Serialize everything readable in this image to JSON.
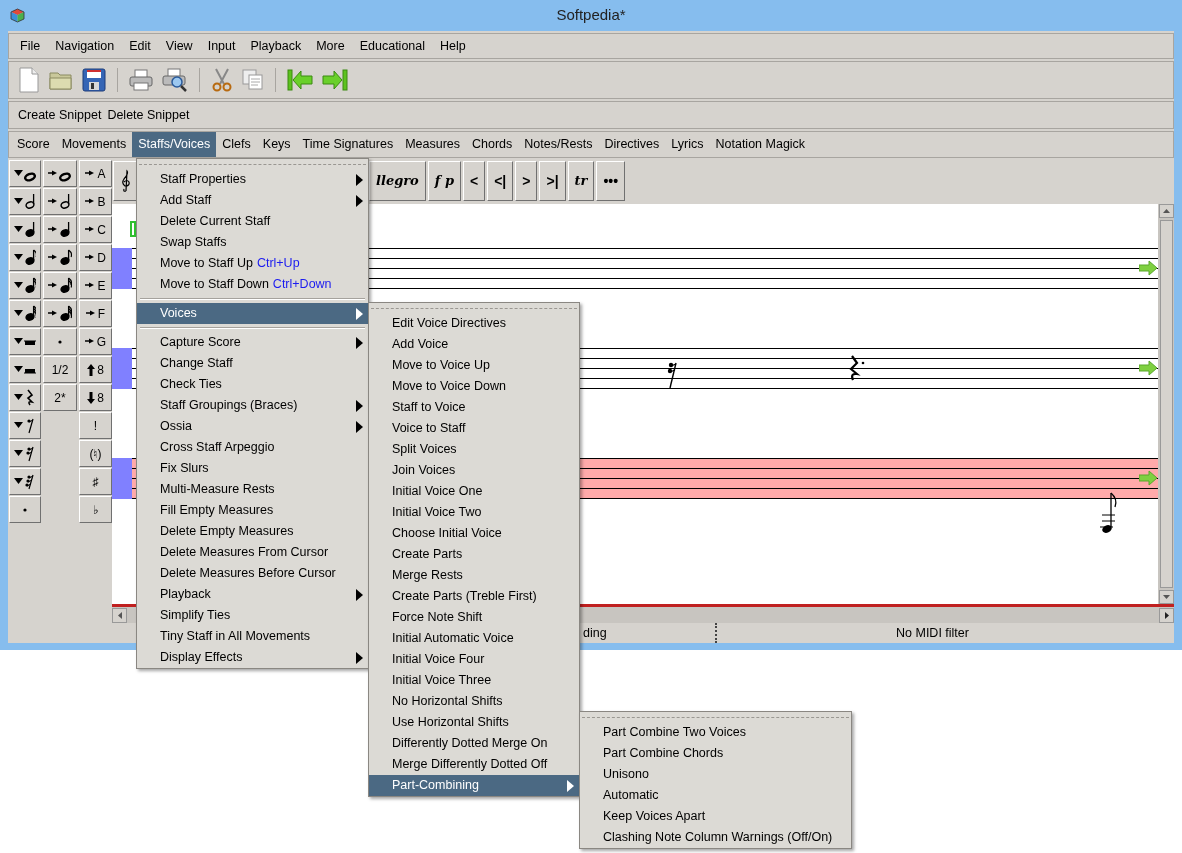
{
  "window": {
    "title": "Softpedia*"
  },
  "menu_bar": [
    "File",
    "Navigation",
    "Edit",
    "View",
    "Input",
    "Playback",
    "More",
    "Educational",
    "Help"
  ],
  "snippet_bar": [
    "Create Snippet",
    "Delete Snippet"
  ],
  "tabs": [
    {
      "label": "Score",
      "selected": false
    },
    {
      "label": "Movements",
      "selected": false
    },
    {
      "label": "Staffs/Voices",
      "selected": true
    },
    {
      "label": "Clefs",
      "selected": false
    },
    {
      "label": "Keys",
      "selected": false
    },
    {
      "label": "Time Signatures",
      "selected": false
    },
    {
      "label": "Measures",
      "selected": false
    },
    {
      "label": "Chords",
      "selected": false
    },
    {
      "label": "Notes/Rests",
      "selected": false
    },
    {
      "label": "Directives",
      "selected": false
    },
    {
      "label": "Lyrics",
      "selected": false
    },
    {
      "label": "Notation Magick",
      "selected": false
    }
  ],
  "palette_columns": [
    [
      {
        "kind": "insertwhole"
      },
      {
        "kind": "inserthalf"
      },
      {
        "kind": "insertquarter"
      },
      {
        "kind": "inserteighth"
      },
      {
        "kind": "insertsixteenth"
      },
      {
        "kind": "insertthirtysecond"
      },
      {
        "kind": "insertwholerest"
      },
      {
        "kind": "inserthalfrest"
      },
      {
        "kind": "insertquarterrest"
      },
      {
        "kind": "inserteighthrest"
      },
      {
        "kind": "insertsixteenthrest"
      },
      {
        "kind": "insertthirtysecondrest"
      },
      {
        "kind": "dot"
      }
    ],
    [
      {
        "kind": "appendwhole"
      },
      {
        "kind": "appendhalf"
      },
      {
        "kind": "appendquarter"
      },
      {
        "kind": "appendeighth"
      },
      {
        "kind": "appendsixteenth"
      },
      {
        "kind": "appendthirtysecond"
      },
      {
        "kind": "dot"
      },
      {
        "kind": "text",
        "label": "1/2"
      },
      {
        "kind": "text",
        "label": "2*"
      }
    ],
    [
      {
        "kind": "pitch",
        "label": "A"
      },
      {
        "kind": "pitch",
        "label": "B"
      },
      {
        "kind": "pitch",
        "label": "C"
      },
      {
        "kind": "pitch",
        "label": "D"
      },
      {
        "kind": "pitch",
        "label": "E"
      },
      {
        "kind": "pitch",
        "label": "F"
      },
      {
        "kind": "pitch",
        "label": "G"
      },
      {
        "kind": "octave-up",
        "label": "8"
      },
      {
        "kind": "octave-down",
        "label": "8"
      },
      {
        "kind": "text",
        "label": "!"
      },
      {
        "kind": "text",
        "label": "(♮)"
      },
      {
        "kind": "text",
        "label": "♯"
      },
      {
        "kind": "text",
        "label": "♭"
      }
    ]
  ],
  "score_toolbar": [
    {
      "kind": "serif",
      "label": "llegro"
    },
    {
      "kind": "serif",
      "label": "f p"
    },
    {
      "kind": "sans",
      "label": "<"
    },
    {
      "kind": "sans",
      "label": "<|"
    },
    {
      "kind": "sans",
      "label": ">"
    },
    {
      "kind": "sans",
      "label": ">|"
    },
    {
      "kind": "serif",
      "label": "tr"
    },
    {
      "kind": "sans",
      "label": "•••"
    }
  ],
  "staffs": [
    {
      "selected": false
    },
    {
      "selected": false
    },
    {
      "selected": true
    }
  ],
  "status_bar": [
    "ding",
    "No MIDI filter"
  ],
  "menus": [
    {
      "items": [
        {
          "kind": "item",
          "label": "Staff Properties",
          "submenu": true,
          "selected": false
        },
        {
          "kind": "item",
          "label": "Add Staff",
          "submenu": true,
          "selected": false
        },
        {
          "kind": "item",
          "label": "Delete Current Staff",
          "submenu": false,
          "selected": false
        },
        {
          "kind": "item",
          "label": "Swap Staffs",
          "submenu": false,
          "selected": false
        },
        {
          "kind": "item",
          "label": "Move to Staff Up",
          "accel": "Ctrl+Up",
          "submenu": false,
          "selected": false
        },
        {
          "kind": "item",
          "label": "Move to Staff Down",
          "accel": "Ctrl+Down",
          "submenu": false,
          "selected": false
        },
        {
          "kind": "separator"
        },
        {
          "kind": "item",
          "label": "Voices",
          "submenu": true,
          "selected": true
        },
        {
          "kind": "separator"
        },
        {
          "kind": "item",
          "label": "Capture Score",
          "submenu": true,
          "selected": false
        },
        {
          "kind": "item",
          "label": "Change Staff",
          "submenu": false,
          "selected": false
        },
        {
          "kind": "item",
          "label": "Check Ties",
          "submenu": false,
          "selected": false
        },
        {
          "kind": "item",
          "label": "Staff Groupings (Braces)",
          "submenu": true,
          "selected": false
        },
        {
          "kind": "item",
          "label": "Ossia",
          "submenu": true,
          "selected": false
        },
        {
          "kind": "item",
          "label": "Cross Staff Arpeggio",
          "submenu": false,
          "selected": false
        },
        {
          "kind": "item",
          "label": "Fix Slurs",
          "submenu": false,
          "selected": false
        },
        {
          "kind": "item",
          "label": "Multi-Measure Rests",
          "submenu": false,
          "selected": false
        },
        {
          "kind": "item",
          "label": "Fill Empty Measures",
          "submenu": false,
          "selected": false
        },
        {
          "kind": "item",
          "label": "Delete Empty Measures",
          "submenu": false,
          "selected": false
        },
        {
          "kind": "item",
          "label": "Delete Measures From Cursor",
          "submenu": false,
          "selected": false
        },
        {
          "kind": "item",
          "label": "Delete Measures Before Cursor",
          "submenu": false,
          "selected": false
        },
        {
          "kind": "item",
          "label": "Playback",
          "submenu": true,
          "selected": false
        },
        {
          "kind": "item",
          "label": "Simplify Ties",
          "submenu": false,
          "selected": false
        },
        {
          "kind": "item",
          "label": "Tiny Staff in All Movements",
          "submenu": false,
          "selected": false
        },
        {
          "kind": "item",
          "label": "Display Effects",
          "submenu": true,
          "selected": false
        }
      ]
    },
    {
      "items": [
        {
          "kind": "item",
          "label": "Edit Voice Directives",
          "submenu": false,
          "selected": false
        },
        {
          "kind": "item",
          "label": "Add Voice",
          "submenu": false,
          "selected": false
        },
        {
          "kind": "item",
          "label": "Move to Voice Up",
          "submenu": false,
          "selected": false
        },
        {
          "kind": "item",
          "label": "Move to Voice Down",
          "submenu": false,
          "selected": false
        },
        {
          "kind": "item",
          "label": "Staff to Voice",
          "submenu": false,
          "selected": false
        },
        {
          "kind": "item",
          "label": "Voice to Staff",
          "submenu": false,
          "selected": false
        },
        {
          "kind": "item",
          "label": "Split Voices",
          "submenu": false,
          "selected": false
        },
        {
          "kind": "item",
          "label": "Join Voices",
          "submenu": false,
          "selected": false
        },
        {
          "kind": "item",
          "label": "Initial Voice One",
          "submenu": false,
          "selected": false
        },
        {
          "kind": "item",
          "label": "Initial Voice Two",
          "submenu": false,
          "selected": false
        },
        {
          "kind": "item",
          "label": "Choose Initial Voice",
          "submenu": false,
          "selected": false
        },
        {
          "kind": "item",
          "label": "Create Parts",
          "submenu": false,
          "selected": false
        },
        {
          "kind": "item",
          "label": "Merge Rests",
          "submenu": false,
          "selected": false
        },
        {
          "kind": "item",
          "label": "Create Parts (Treble First)",
          "submenu": false,
          "selected": false
        },
        {
          "kind": "item",
          "label": "Force Note Shift",
          "submenu": false,
          "selected": false
        },
        {
          "kind": "item",
          "label": "Initial Automatic Voice",
          "submenu": false,
          "selected": false
        },
        {
          "kind": "item",
          "label": "Initial Voice Four",
          "submenu": false,
          "selected": false
        },
        {
          "kind": "item",
          "label": "Initial Voice Three",
          "submenu": false,
          "selected": false
        },
        {
          "kind": "item",
          "label": "No Horizontal Shifts",
          "submenu": false,
          "selected": false
        },
        {
          "kind": "item",
          "label": "Use Horizontal Shifts",
          "submenu": false,
          "selected": false
        },
        {
          "kind": "item",
          "label": "Differently Dotted Merge On",
          "submenu": false,
          "selected": false
        },
        {
          "kind": "item",
          "label": "Merge Differently Dotted Off",
          "submenu": false,
          "selected": false
        },
        {
          "kind": "item",
          "label": "Part-Combining",
          "submenu": true,
          "selected": true
        }
      ]
    },
    {
      "items": [
        {
          "kind": "item",
          "label": "Part Combine Two Voices",
          "submenu": false,
          "selected": false
        },
        {
          "kind": "item",
          "label": "Part Combine Chords",
          "submenu": false,
          "selected": false
        },
        {
          "kind": "item",
          "label": "Unisono",
          "submenu": false,
          "selected": false
        },
        {
          "kind": "item",
          "label": "Automatic",
          "submenu": false,
          "selected": false
        },
        {
          "kind": "item",
          "label": "Keep Voices Apart",
          "submenu": false,
          "selected": false
        },
        {
          "kind": "item",
          "label": "Clashing Note Column Warnings (Off/On)",
          "submenu": false,
          "selected": false
        }
      ]
    }
  ]
}
